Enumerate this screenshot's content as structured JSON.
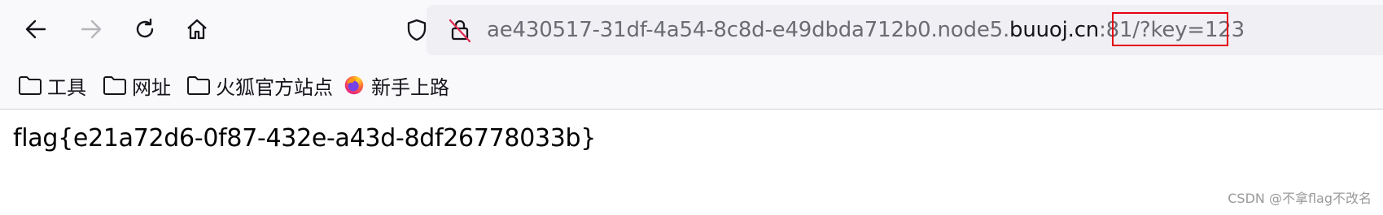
{
  "toolbar": {
    "back_icon": "arrow-left-icon",
    "forward_icon": "arrow-right-icon",
    "reload_icon": "reload-icon",
    "home_icon": "home-icon"
  },
  "urlbar": {
    "shield_icon": "shield-icon",
    "lock_icon": "insecure-lock-icon",
    "url_prefix": "ae430517-31df-4a54-8c8d-e49dbda712b0.node5.",
    "url_host": "buuoj.cn",
    "url_suffix": ":81/?key=123",
    "highlight_color": "#e60012"
  },
  "bookmarks": [
    {
      "label": "工具",
      "icon": "folder-icon"
    },
    {
      "label": "网址",
      "icon": "folder-icon"
    },
    {
      "label": "火狐官方站点",
      "icon": "folder-icon"
    },
    {
      "label": "新手上路",
      "icon": "firefox-icon"
    }
  ],
  "content": {
    "flag": "flag{e21a72d6-0f87-432e-a43d-8df26778033b}"
  },
  "watermark": "CSDN @不拿flag不改名"
}
